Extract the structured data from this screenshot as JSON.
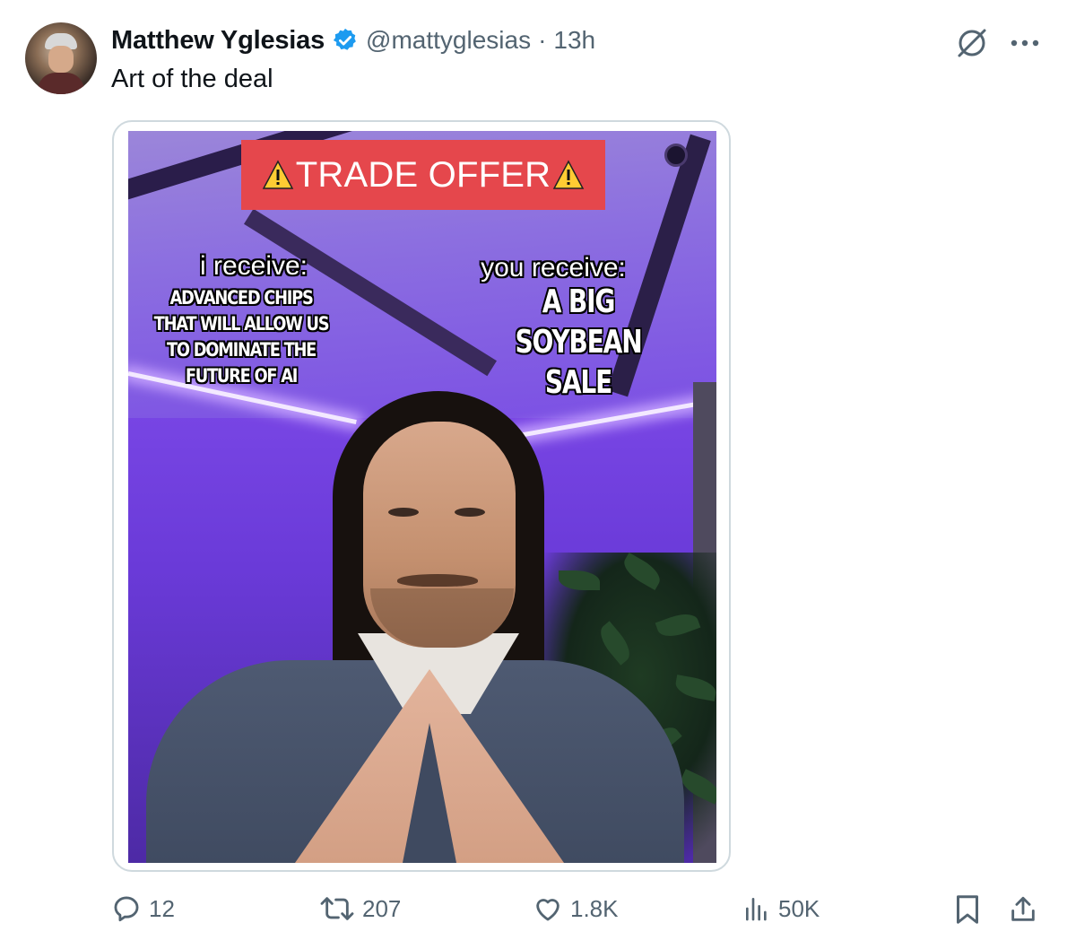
{
  "tweet": {
    "author_name": "Matthew Yglesias",
    "handle": "@mattyglesias",
    "separator": "·",
    "time": "13h",
    "text": "Art of the deal",
    "verified_color": "#1d9bf0"
  },
  "meme": {
    "banner_text": "TRADE OFFER",
    "banner_color": "#e5474c",
    "i_receive_label": "i receive:",
    "i_receive_text": "ADVANCED CHIPS THAT WILL ALLOW US TO DOMINATE THE FUTURE OF AI",
    "you_receive_label": "you receive:",
    "you_receive_text": "A BIG SOYBEAN SALE"
  },
  "actions": {
    "replies": "12",
    "reposts": "207",
    "likes": "1.8K",
    "views": "50K"
  },
  "icons": [
    "grok-icon",
    "more-icon",
    "reply-icon",
    "repost-icon",
    "like-icon",
    "views-icon",
    "bookmark-icon",
    "share-icon",
    "warning-icon",
    "verified-badge-icon"
  ],
  "colors": {
    "text": "#0f1419",
    "muted": "#536471",
    "border": "#cfd9de"
  }
}
